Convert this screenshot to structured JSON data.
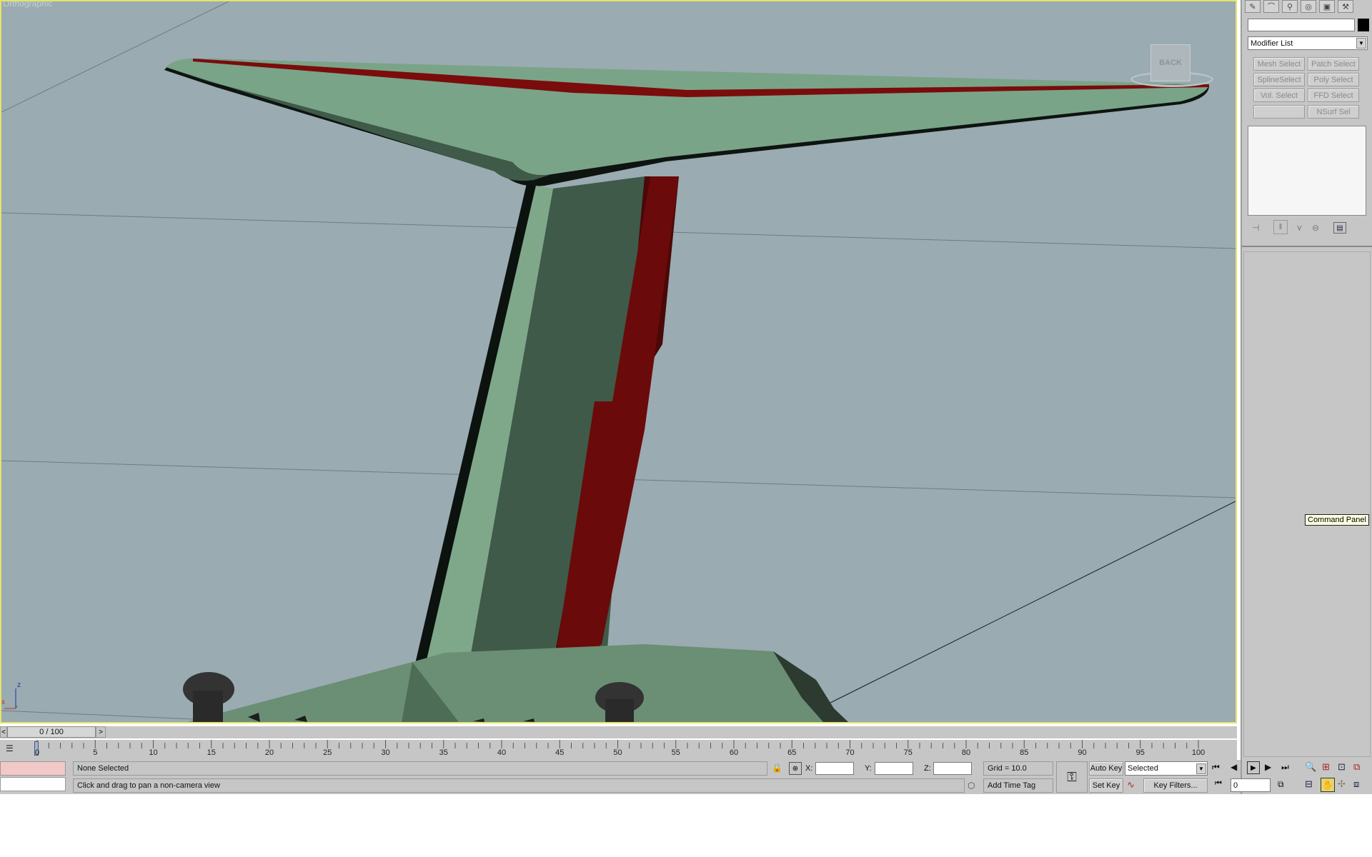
{
  "viewport": {
    "label": "Orthographic",
    "viewcube_label": "BACK",
    "axis_labels": {
      "z": "z",
      "x": "x"
    }
  },
  "command_panel": {
    "tabs": [
      "create-icon",
      "modify-icon",
      "hierarchy-icon",
      "motion-icon",
      "display-icon",
      "utilities-icon"
    ],
    "name_field_value": "",
    "modifier_list_label": "Modifier List",
    "modifier_buttons": [
      "Mesh Select",
      "Patch Select",
      "SplineSelect",
      "Poly Select",
      "Vol. Select",
      "FFD Select",
      "",
      "NSurf Sel"
    ],
    "tooltip": "Command Panel"
  },
  "timeline": {
    "frame_counter": "0 / 100",
    "prev_arrow": "<",
    "next_arrow": ">",
    "ticks": [
      "0",
      "5",
      "10",
      "15",
      "20",
      "25",
      "30",
      "35",
      "40",
      "45",
      "50",
      "55",
      "60",
      "65",
      "70",
      "75",
      "80",
      "85",
      "90",
      "95",
      "100"
    ]
  },
  "status": {
    "selection": "None Selected",
    "prompt": "Click and drag to pan a non-camera view",
    "x_label": "X:",
    "y_label": "Y:",
    "z_label": "Z:",
    "x_value": "",
    "y_value": "",
    "z_value": "",
    "grid": "Grid = 10.0",
    "add_time_tag": "Add Time Tag"
  },
  "animation": {
    "auto_key": "Auto Key",
    "set_key": "Set Key",
    "selected_option": "Selected",
    "key_filters": "Key Filters...",
    "current_frame": "0"
  },
  "colors": {
    "viewport_bg": "#9aabb2",
    "active_border": "#e4e46a",
    "panel_bg": "#c6c6c6",
    "model_green": "#7fa88a",
    "model_red": "#7a0c0c"
  }
}
